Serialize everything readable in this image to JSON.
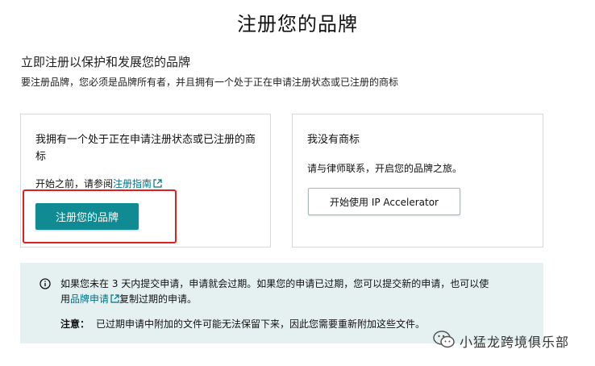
{
  "page": {
    "title": "注册您的品牌",
    "subtitle": "立即注册以保护和发展您的品牌",
    "description": "要注册品牌，您必须是品牌所有者，并且拥有一个处于正在申请注册状态或已注册的商标"
  },
  "left_card": {
    "heading": "我拥有一个处于正在申请注册状态或已注册的商标",
    "guide_prefix": "开始之前，请参阅",
    "guide_link": "注册指南",
    "button_label": "注册您的品牌"
  },
  "right_card": {
    "heading": "我没有商标",
    "text": "请与律师联系，开启您的品牌之旅。",
    "button_label": "开始使用 IP Accelerator"
  },
  "notice": {
    "line1": "如果您未在 3 天内提交申请，申请就会过期。如果您的申请已过期，您可以提交新的申请，也可以使",
    "line2_prefix": "用",
    "line2_link": "品牌申请",
    "line2_suffix": "复制过期的申请。",
    "note_label": "注意：",
    "note_text": "已过期申请中附加的文件可能无法保留下来，因此您需要重新附加这些文件。"
  },
  "watermark": {
    "text": "小猛龙跨境俱乐部",
    "icon": "wechat-icon"
  },
  "colors": {
    "primary": "#108a93",
    "link": "#007185",
    "notice_bg": "#e5f1f1",
    "highlight": "#e02020"
  }
}
